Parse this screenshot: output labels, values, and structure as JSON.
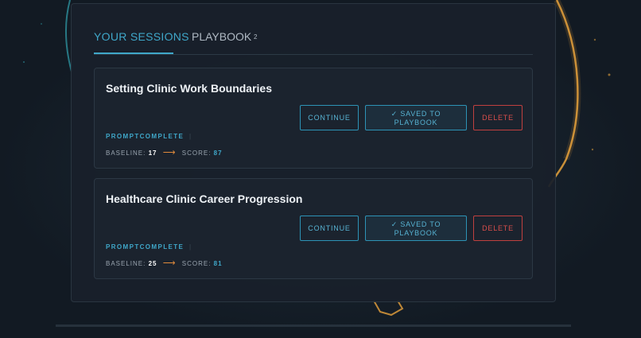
{
  "tabs": {
    "sessions_label": "YOUR SESSIONS",
    "playbook_label": "PLAYBOOK",
    "playbook_count": "2"
  },
  "sessions": [
    {
      "title": "Setting Clinic Work Boundaries",
      "continue_label": "CONTINUE",
      "saved_label": "✓ SAVED TO PLAYBOOK",
      "delete_label": "DELETE",
      "status": "PROMPTCOMPLETE",
      "baseline_label": "BASELINE:",
      "baseline": "17",
      "arrow": "⟶",
      "score_label": "SCORE:",
      "score": "87"
    },
    {
      "title": "Healthcare Clinic Career Progression",
      "continue_label": "CONTINUE",
      "saved_label": "✓ SAVED TO PLAYBOOK",
      "delete_label": "DELETE",
      "status": "PROMPTCOMPLETE",
      "baseline_label": "BASELINE:",
      "baseline": "25",
      "arrow": "⟶",
      "score_label": "SCORE:",
      "score": "81"
    }
  ],
  "colors": {
    "accent": "#3fa7c9",
    "danger": "#d94e4b",
    "arrow": "#e08a3c",
    "glow": "#e8a33c"
  }
}
